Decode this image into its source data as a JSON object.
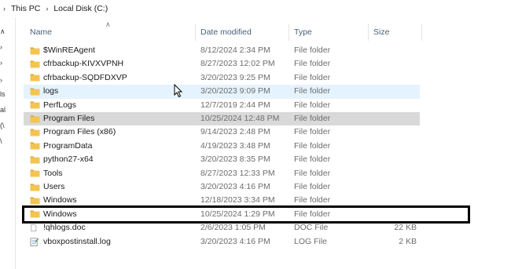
{
  "breadcrumb": {
    "items": [
      "This PC",
      "Local Disk (C:)"
    ]
  },
  "nav_strip": {
    "fragments": [
      "ls",
      "al",
      "(\\",
      "\\"
    ]
  },
  "columns": {
    "name": "Name",
    "date": "Date modified",
    "type": "Type",
    "size": "Size"
  },
  "files": [
    {
      "name": "$WinREAgent",
      "date": "8/12/2024 2:34 PM",
      "type": "File folder",
      "size": "",
      "icon": "folder-icon"
    },
    {
      "name": "cfrbackup-KIVXVPNH",
      "date": "8/27/2023 12:02 PM",
      "type": "File folder",
      "size": "",
      "icon": "folder-icon"
    },
    {
      "name": "cfrbackup-SQDFDXVP",
      "date": "3/20/2023 9:25 PM",
      "type": "File folder",
      "size": "",
      "icon": "folder-icon"
    },
    {
      "name": "logs",
      "date": "3/20/2023 9:09 PM",
      "type": "File folder",
      "size": "",
      "icon": "folder-icon"
    },
    {
      "name": "PerfLogs",
      "date": "12/7/2019 2:44 PM",
      "type": "File folder",
      "size": "",
      "icon": "folder-icon"
    },
    {
      "name": "Program Files",
      "date": "10/25/2024 12:48 PM",
      "type": "File folder",
      "size": "",
      "icon": "folder-icon"
    },
    {
      "name": "Program Files (x86)",
      "date": "9/14/2023 2:48 PM",
      "type": "File folder",
      "size": "",
      "icon": "folder-icon"
    },
    {
      "name": "ProgramData",
      "date": "4/19/2023 3:48 PM",
      "type": "File folder",
      "size": "",
      "icon": "folder-icon"
    },
    {
      "name": "python27-x64",
      "date": "3/20/2023 8:35 PM",
      "type": "File folder",
      "size": "",
      "icon": "folder-icon"
    },
    {
      "name": "Tools",
      "date": "8/27/2023 12:33 PM",
      "type": "File folder",
      "size": "",
      "icon": "folder-icon"
    },
    {
      "name": "Users",
      "date": "3/20/2023 4:16 PM",
      "type": "File folder",
      "size": "",
      "icon": "folder-icon"
    },
    {
      "name": "Windows",
      "date": "12/18/2023 3:34 PM",
      "type": "File folder",
      "size": "",
      "icon": "folder-icon"
    },
    {
      "name": "Windows",
      "date": "10/25/2024 1:29 PM",
      "type": "File folder",
      "size": "",
      "icon": "folder-icon"
    },
    {
      "name": "!qhlogs.doc",
      "date": "2/6/2023 1:05 PM",
      "type": "DOC File",
      "size": "22 KB",
      "icon": "document-icon"
    },
    {
      "name": "vboxpostinstall.log",
      "date": "3/20/2023 4:16 PM",
      "type": "LOG File",
      "size": "2 KB",
      "icon": "log-file-icon"
    }
  ],
  "hover_row": 3,
  "selected_row": 5,
  "boxed_row": 12,
  "colors": {
    "folder": "#f4c451",
    "folder_dark": "#dca532",
    "hover": "#e5f3ff",
    "selected": "#d9d9d9",
    "header_text": "#4c607a"
  }
}
